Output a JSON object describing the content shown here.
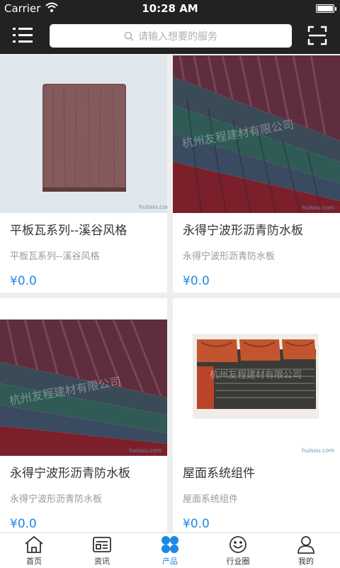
{
  "status_bar": {
    "carrier": "Carrier",
    "time": "10:28 AM"
  },
  "header": {
    "search_placeholder": "请输入想要的服务"
  },
  "products": [
    {
      "title": "平板瓦系列--溪谷风格",
      "subtitle": "平板瓦系列--溪谷风格",
      "price": "¥0.0",
      "image": "flat-tile"
    },
    {
      "title": "永得宁波形沥青防水板",
      "subtitle": "永得宁波形沥青防水板",
      "price": "¥0.0",
      "image": "corrugated-sheets",
      "watermark": "huisou.com"
    },
    {
      "title": "永得宁波形沥青防水板",
      "subtitle": "永得宁波形沥青防水板",
      "price": "¥0.0",
      "image": "corrugated-sheets",
      "watermark": "huisou.com"
    },
    {
      "title": "屋面系统组件",
      "subtitle": "屋面系统组件",
      "price": "¥0.0",
      "image": "roof-components",
      "watermark": "huisou.com"
    }
  ],
  "flat_tile_watermark": "huisou.com",
  "tabs": [
    {
      "label": "首页",
      "icon": "home-icon"
    },
    {
      "label": "资讯",
      "icon": "news-icon"
    },
    {
      "label": "产品",
      "icon": "products-icon",
      "active": true
    },
    {
      "label": "行业圈",
      "icon": "circle-icon"
    },
    {
      "label": "我的",
      "icon": "profile-icon"
    }
  ],
  "colors": {
    "header_bg": "#222222",
    "accent": "#1e88e5",
    "price": "#1e88e5"
  }
}
